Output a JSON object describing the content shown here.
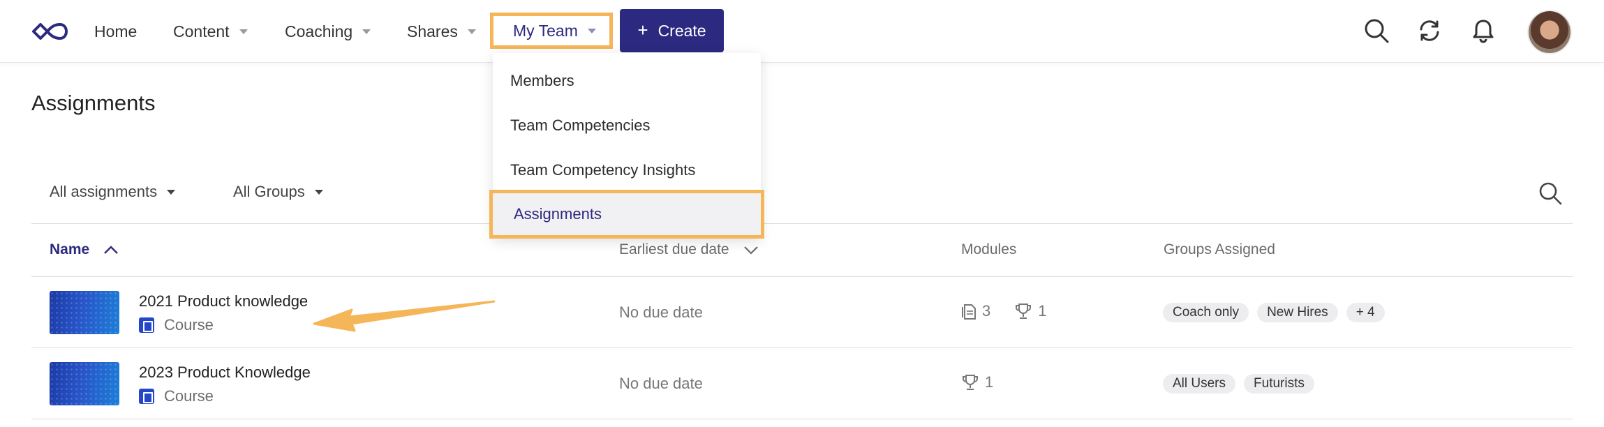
{
  "nav": {
    "home": "Home",
    "content": "Content",
    "coaching": "Coaching",
    "shares": "Shares",
    "my_team": "My Team",
    "create": "Create"
  },
  "menu": {
    "items": [
      "Members",
      "Team Competencies",
      "Team Competency Insights",
      "Assignments"
    ]
  },
  "page": {
    "title": "Assignments"
  },
  "filters": {
    "assignments": "All assignments",
    "groups": "All Groups"
  },
  "table": {
    "headers": {
      "name": "Name",
      "due": "Earliest due date",
      "modules": "Modules",
      "groups": "Groups Assigned"
    },
    "rows": [
      {
        "title": "2021 Product knowledge",
        "type": "Course",
        "due": "No due date",
        "docs": "3",
        "trophies": "1",
        "chips": [
          "Coach only",
          "New Hires",
          "+ 4"
        ]
      },
      {
        "title": "2023 Product Knowledge",
        "type": "Course",
        "due": "No due date",
        "trophies": "1",
        "chips": [
          "All Users",
          "Futurists"
        ]
      }
    ]
  },
  "colors": {
    "brand": "#2c2a80",
    "highlight": "#f5b65a",
    "accent_text": "#2d2a7e"
  }
}
